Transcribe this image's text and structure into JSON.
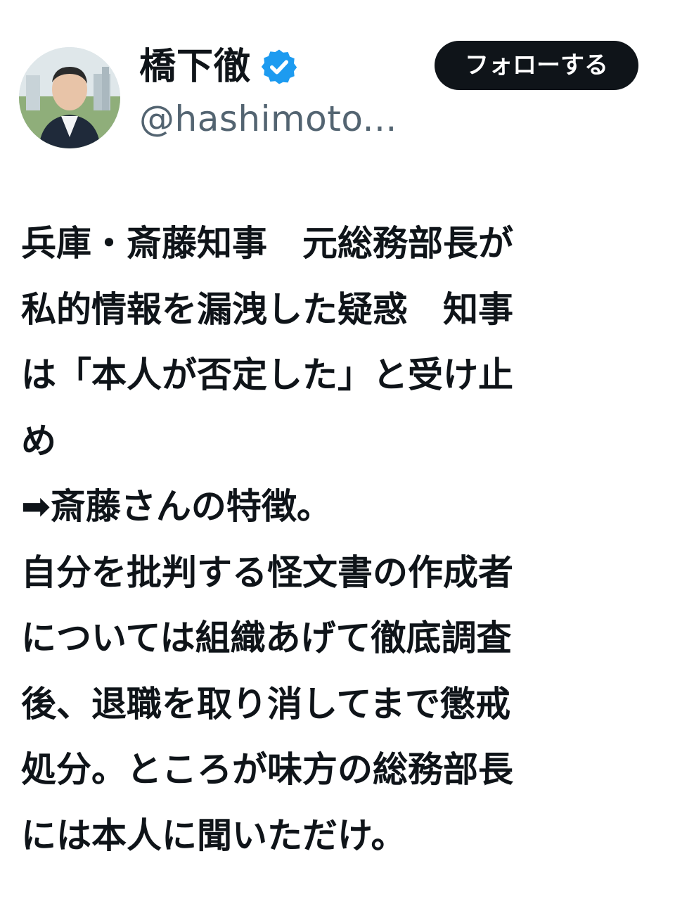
{
  "author": {
    "display_name": "橋下徹",
    "handle": "@hashimoto...",
    "verified": true,
    "badge_color": "#1d9bf0"
  },
  "actions": {
    "follow_label": "フォローする"
  },
  "tweet": {
    "lines": [
      "兵庫・斎藤知事　元総務部長が",
      "私的情報を漏洩した疑惑　知事",
      "は「本人が否定した」と受け止",
      "め",
      "➡斎藤さんの特徴。",
      "自分を批判する怪文書の作成者",
      "については組織あげて徹底調査",
      "後、退職を取り消してまで懲戒",
      "処分。ところが味方の総務部長",
      "には本人に聞いただけ。"
    ]
  }
}
